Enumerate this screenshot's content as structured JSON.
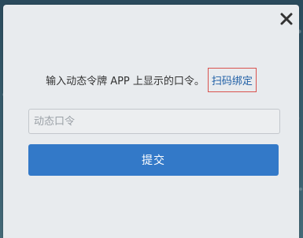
{
  "dialog": {
    "close_icon": "close-icon",
    "instruction_text": "输入动态令牌 APP 上显示的口令。",
    "bind_link_label": "扫码绑定",
    "code_input": {
      "value": "",
      "placeholder": "动态口令"
    },
    "submit_label": "提交"
  },
  "colors": {
    "dialog_bg": "#e8ebee",
    "primary_button": "#3379c8",
    "link": "#1f5fa6",
    "link_highlight_border": "#d9534f"
  }
}
